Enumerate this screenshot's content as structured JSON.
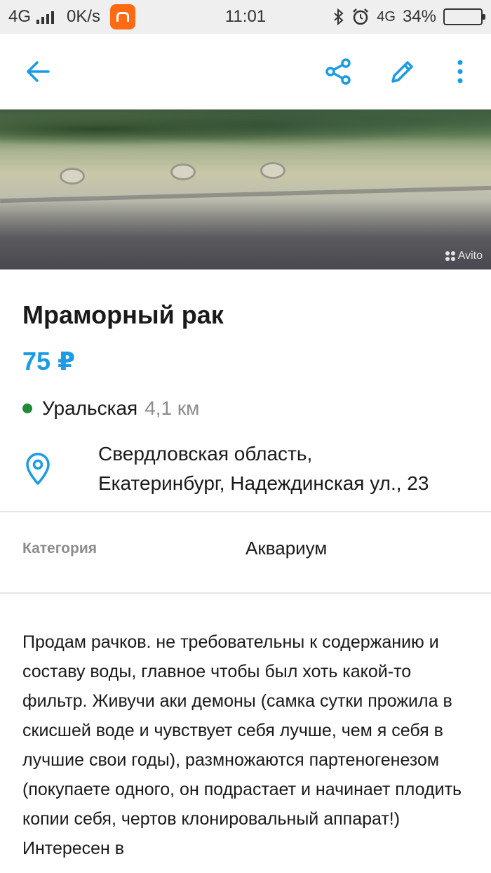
{
  "status_bar": {
    "network": "4G",
    "speed": "0K/s",
    "time": "11:01",
    "network_right": "4G",
    "battery": "34%",
    "battery_level": 0.34
  },
  "photo": {
    "watermark": "Avito"
  },
  "listing": {
    "title": "Мраморный рак",
    "price": "75 ₽",
    "metro_station": "Уральская",
    "metro_distance": "4,1 км",
    "address_line1": "Свердловская область,",
    "address_line2": "Екатеринбург, Надеждинская ул., 23",
    "category_label": "Категория",
    "category_value": "Аквариум",
    "description": "Продам рачков. не требовательны к содержанию и составу воды, главное чтобы был хоть какой-то фильтр. Живучи аки демоны (самка сутки прожила в скисшей воде и чувствует себя лучше, чем я себя в лучшие свои годы), размножаются партеногенезом (покупаете одного, он подрастает и начинает плодить копии себя, чертов клонировальный аппарат!) Интересен в"
  },
  "colors": {
    "accent": "#1a9be6",
    "metro_line": "#1e8a3a",
    "muted": "#8c8c8c"
  },
  "icons": {
    "back": "arrow-left-icon",
    "share": "share-icon",
    "edit": "pencil-icon",
    "more": "more-vertical-icon",
    "location": "map-pin-icon"
  }
}
